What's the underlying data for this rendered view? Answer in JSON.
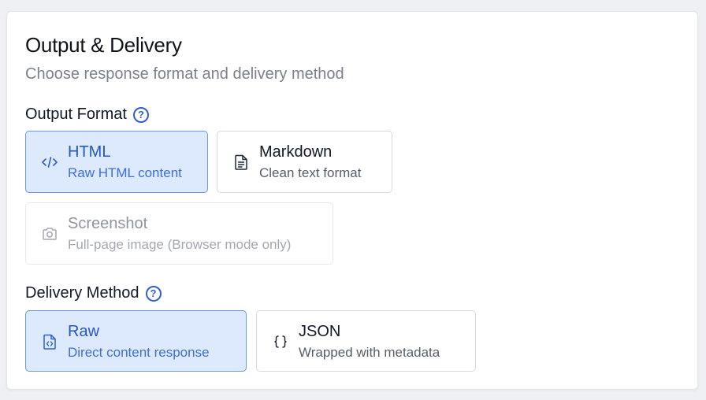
{
  "header": {
    "title": "Output & Delivery",
    "subtitle": "Choose response format and delivery method"
  },
  "output_format": {
    "label": "Output Format",
    "help_icon": "question-circle-icon",
    "options": [
      {
        "label": "HTML",
        "description": "Raw HTML content",
        "icon": "code-icon",
        "state": "selected"
      },
      {
        "label": "Markdown",
        "description": "Clean text format",
        "icon": "document-icon",
        "state": "default"
      },
      {
        "label": "Screenshot",
        "description": "Full-page image (Browser mode only)",
        "icon": "camera-icon",
        "state": "disabled"
      }
    ]
  },
  "delivery_method": {
    "label": "Delivery Method",
    "help_icon": "question-circle-icon",
    "options": [
      {
        "label": "Raw",
        "description": "Direct content response",
        "icon": "code-file-icon",
        "state": "selected"
      },
      {
        "label": "JSON",
        "description": "Wrapped with metadata",
        "icon": "braces-icon",
        "state": "default"
      }
    ]
  },
  "colors": {
    "accent": "#2f5fd0",
    "selected_bg": "#dde9fc",
    "selected_border": "#6d98e6",
    "border": "#d6d9de"
  }
}
